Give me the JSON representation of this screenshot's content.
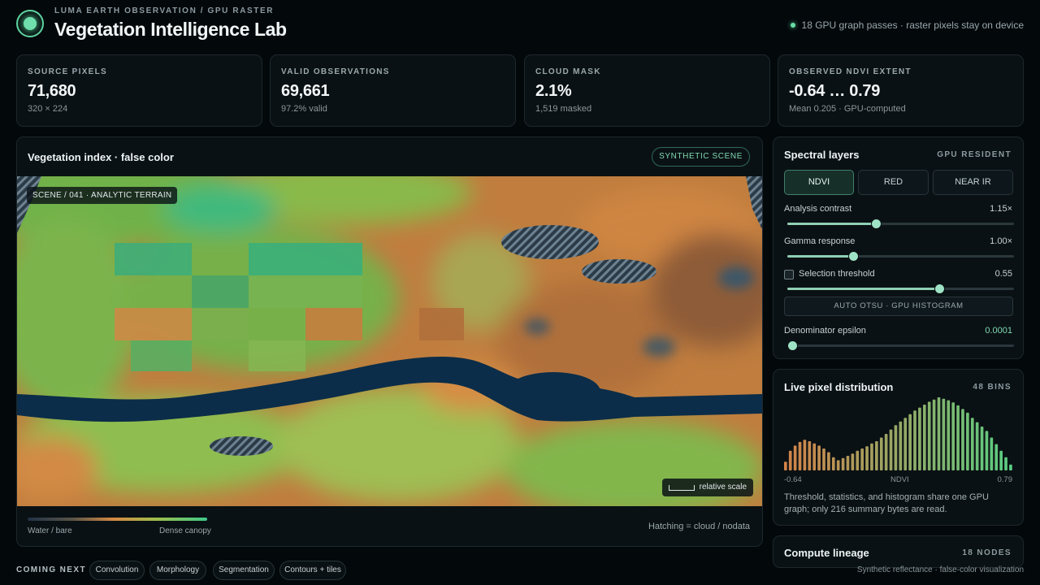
{
  "header": {
    "eyebrow": "LUMA EARTH OBSERVATION / GPU RASTER",
    "title": "Vegetation Intelligence Lab",
    "status": "18 GPU graph passes · raster pixels stay on device"
  },
  "stats": [
    {
      "label": "SOURCE PIXELS",
      "value": "71,680",
      "sub": "320 × 224"
    },
    {
      "label": "VALID OBSERVATIONS",
      "value": "69,661",
      "sub": "97.2% valid"
    },
    {
      "label": "CLOUD MASK",
      "value": "2.1%",
      "sub": "1,519 masked"
    },
    {
      "label": "OBSERVED NDVI EXTENT",
      "value": "-0.64 … 0.79",
      "sub": "Mean 0.205 · GPU-computed"
    }
  ],
  "map": {
    "title": "Vegetation index · false color",
    "badge": "SYNTHETIC SCENE",
    "scene_tag": "SCENE / 041 · ANALYTIC TERRAIN",
    "scale_label": "relative scale",
    "legend_left": "Water / bare",
    "legend_right": "Dense canopy",
    "hatch_note": "Hatching = cloud / nodata"
  },
  "layers": {
    "title": "Spectral layers",
    "tag": "GPU RESIDENT",
    "tabs": [
      {
        "label": "NDVI",
        "active": true
      },
      {
        "label": "RED",
        "active": false
      },
      {
        "label": "NEAR IR",
        "active": false
      }
    ],
    "contrast": {
      "label": "Analysis contrast",
      "value": "1.15×",
      "level": 0.39
    },
    "gamma": {
      "label": "Gamma response",
      "value": "1.00×",
      "level": 0.29
    },
    "threshold": {
      "label": "Selection threshold",
      "value": "0.55",
      "level": 0.67,
      "checked": false
    },
    "otsu_button": "AUTO OTSU · GPU HISTOGRAM",
    "epsilon": {
      "label": "Denominator epsilon",
      "value": "0.0001",
      "level": 0.0
    }
  },
  "distribution": {
    "title": "Live pixel distribution",
    "tag": "48 BINS",
    "min_label": "-0.64",
    "axis_label": "NDVI",
    "max_label": "0.79",
    "note": "Threshold, statistics, and histogram share one GPU graph; only 216 summary bytes are read.",
    "bins": [
      0.12,
      0.27,
      0.34,
      0.39,
      0.42,
      0.4,
      0.37,
      0.34,
      0.3,
      0.25,
      0.18,
      0.14,
      0.17,
      0.2,
      0.23,
      0.27,
      0.3,
      0.33,
      0.37,
      0.4,
      0.45,
      0.5,
      0.56,
      0.62,
      0.67,
      0.72,
      0.77,
      0.82,
      0.86,
      0.9,
      0.94,
      0.97,
      1.0,
      0.98,
      0.96,
      0.93,
      0.89,
      0.84,
      0.79,
      0.72,
      0.66,
      0.6,
      0.54,
      0.45,
      0.36,
      0.27,
      0.18,
      0.08
    ]
  },
  "lineage": {
    "title": "Compute lineage",
    "tag": "18 NODES"
  },
  "footer": {
    "coming_label": "COMING NEXT",
    "chips": [
      "Convolution",
      "Morphology",
      "Segmentation",
      "Contours + tiles"
    ],
    "footnote": "Synthetic reflectance · false-color visualization"
  },
  "colors": {
    "accent": "#5fd3a0",
    "background": "#03080b",
    "panel": "#0a1114",
    "water": "#0a2a44"
  }
}
